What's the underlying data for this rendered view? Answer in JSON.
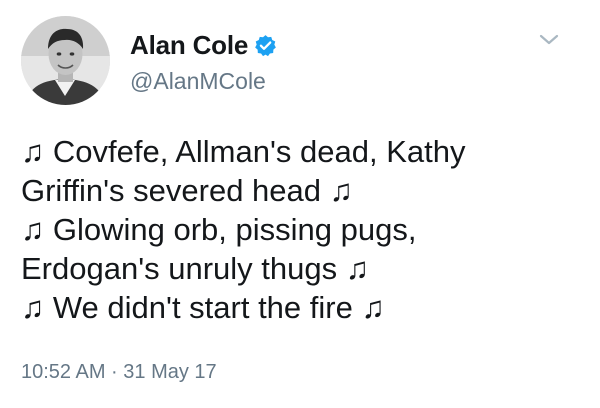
{
  "author": {
    "display_name": "Alan Cole",
    "handle": "@AlanMCole",
    "verified": true,
    "avatar_icon": "profile-photo"
  },
  "icons": {
    "verified": "verified-badge-icon",
    "menu": "chevron-down-icon",
    "accent": "#1da1f2"
  },
  "tweet": {
    "lines": [
      "♫ Covfefe, Allman's dead, Kathy",
      "Griffin's severed head ♫",
      "♫ Glowing orb, pissing pugs,",
      "Erdogan's unruly thugs ♫",
      "♫ We didn't start the fire ♫"
    ],
    "timestamp": "10:52 AM · 31 May 17"
  }
}
